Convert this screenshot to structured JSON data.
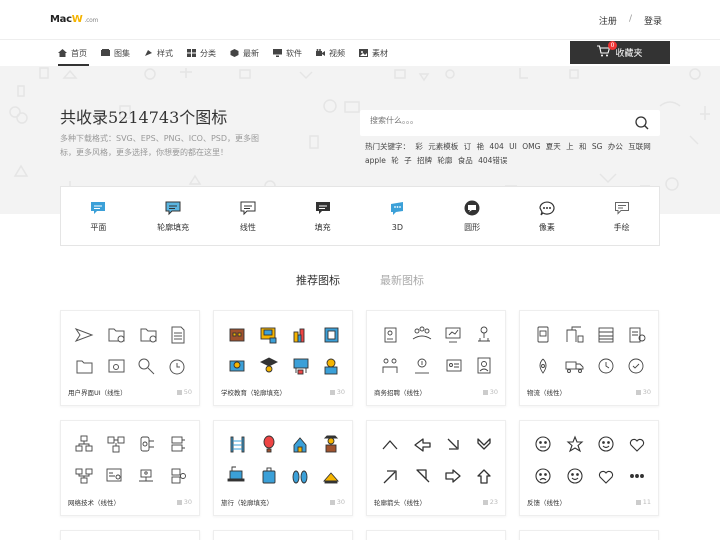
{
  "logo": {
    "m": "Mac",
    "w": "W",
    "dom": ".com"
  },
  "auth": {
    "register": "注册",
    "sep": "/",
    "login": "登录"
  },
  "nav": [
    "首页",
    "图集",
    "样式",
    "分类",
    "最新",
    "软件",
    "视频",
    "素材"
  ],
  "fav": {
    "label": "收藏夹",
    "count": "0"
  },
  "hero": {
    "title": "共收录5214743个图标",
    "sub": "多种下载格式：SVG、EPS、PNG、ICO、PSD，更多图标，更多风格，更多选择，你想要的都在这里！",
    "search_placeholder": "搜索什么。。。",
    "hot": "热门关键字： 彩  元素模板  订  艳  404  UI  OMG  夏天  上  和  SG  办公  互联网  apple  轮  子  招牌  轮廓  食品  404错误"
  },
  "categories": [
    "平面",
    "轮廓填充",
    "线性",
    "填充",
    "3D",
    "圆形",
    "像素",
    "手绘"
  ],
  "tabs": [
    "推荐图标",
    "最新图标"
  ],
  "cards": [
    {
      "title": "用户界面UI（线性）",
      "count": "50"
    },
    {
      "title": "学校教育（轮廓填充）",
      "count": "30"
    },
    {
      "title": "商务招聘（线性）",
      "count": "30"
    },
    {
      "title": "物流（线性）",
      "count": "30"
    },
    {
      "title": "网络技术（线性）",
      "count": "30"
    },
    {
      "title": "旅行（轮廓填充）",
      "count": "30"
    },
    {
      "title": "轮廓箭头（线性）",
      "count": "23"
    },
    {
      "title": "反馈（线性）",
      "count": "11"
    }
  ],
  "colors": {
    "accent": "#333333",
    "badge": "#e33333",
    "blue": "#3ba0d8",
    "yellow": "#f5b400"
  }
}
